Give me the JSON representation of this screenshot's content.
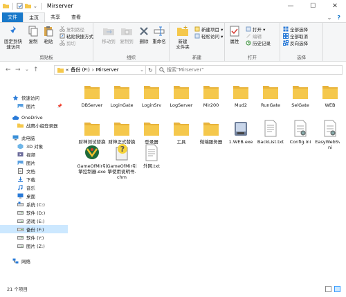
{
  "window": {
    "title": "Mirserver",
    "minimize": "—",
    "maximize": "☐",
    "close": "✕"
  },
  "tabs": [
    {
      "label": "文件"
    },
    {
      "label": "主页"
    },
    {
      "label": "共享"
    },
    {
      "label": "查看"
    }
  ],
  "ribbon": {
    "clipboard": {
      "label": "剪贴板",
      "pin": "固定到快\n速访问",
      "copy": "复制",
      "paste": "粘贴",
      "copy_path": "复制路径",
      "paste_shortcut": "粘贴快捷方式",
      "cut": "剪切"
    },
    "organize": {
      "label": "组织",
      "move_to": "移动到",
      "copy_to": "复制到",
      "delete": "删除",
      "rename": "重命名"
    },
    "new": {
      "label": "新建",
      "new_folder": "新建\n文件夹",
      "new_item": "新建项目 ▾",
      "easy_access": "轻松访问 ▾"
    },
    "open": {
      "label": "打开",
      "properties": "属性",
      "open": "打开 ▾",
      "edit": "编辑",
      "history": "历史记录"
    },
    "select": {
      "label": "选择",
      "select_all": "全部选择",
      "select_none": "全部取消",
      "invert": "反向选择"
    }
  },
  "address": {
    "back": "←",
    "forward": "→",
    "up_history": "⌄",
    "up": "↑",
    "path_prefix": "«",
    "path": [
      "备份 (F:)",
      "Mirserver"
    ],
    "path_sep": "›",
    "dropdown": "⌄",
    "refresh": "↻",
    "search_placeholder": "搜索\"Mirserver\""
  },
  "nav": [
    {
      "label": "快速访问",
      "icon": "star-icon",
      "pinned": false
    },
    {
      "label": "图片",
      "icon": "pictures-folder-icon",
      "pinned": true
    },
    {
      "label": "OneDrive",
      "icon": "cloud-icon",
      "pinned": false
    },
    {
      "label": "战鹰小组登录器",
      "icon": "folder-icon",
      "pinned": false
    },
    {
      "label": "此电脑",
      "icon": "computer-icon",
      "pinned": false
    },
    {
      "label": "3D 对象",
      "icon": "3d-objects-icon",
      "pinned": false
    },
    {
      "label": "视频",
      "icon": "videos-icon",
      "pinned": false
    },
    {
      "label": "图片",
      "icon": "pictures-icon",
      "pinned": false
    },
    {
      "label": "文档",
      "icon": "documents-icon",
      "pinned": false
    },
    {
      "label": "下载",
      "icon": "downloads-icon",
      "pinned": false
    },
    {
      "label": "音乐",
      "icon": "music-icon",
      "pinned": false
    },
    {
      "label": "桌面",
      "icon": "desktop-icon",
      "pinned": false
    },
    {
      "label": "系统 (C:)",
      "icon": "drive-c-icon",
      "pinned": false
    },
    {
      "label": "软件 (D:)",
      "icon": "drive-icon",
      "pinned": false
    },
    {
      "label": "游戏 (E:)",
      "icon": "drive-icon",
      "pinned": false
    },
    {
      "label": "备份 (F:)",
      "icon": "drive-icon",
      "pinned": false,
      "selected": true
    },
    {
      "label": "软件 (Y:)",
      "icon": "drive-icon",
      "pinned": false
    },
    {
      "label": "图片 (Z:)",
      "icon": "drive-icon",
      "pinned": false
    },
    {
      "label": "网络",
      "icon": "network-icon",
      "pinned": false
    }
  ],
  "nav_pin_glyph": "📌",
  "files": [
    {
      "name": "DBServer",
      "type": "folder"
    },
    {
      "name": "LoginGate",
      "type": "folder"
    },
    {
      "name": "LoginSrv",
      "type": "folder"
    },
    {
      "name": "LogServer",
      "type": "folder"
    },
    {
      "name": "Mir200",
      "type": "folder"
    },
    {
      "name": "Mud2",
      "type": "folder"
    },
    {
      "name": "RunGate",
      "type": "folder"
    },
    {
      "name": "SelGate",
      "type": "folder"
    },
    {
      "name": "WEB",
      "type": "folder"
    },
    {
      "name": "财神测试替换",
      "type": "folder"
    },
    {
      "name": "财神正式替换",
      "type": "folder"
    },
    {
      "name": "登录器",
      "type": "folder"
    },
    {
      "name": "工具",
      "type": "folder"
    },
    {
      "name": "微端服务器",
      "type": "folder"
    },
    {
      "name": "1.WEB.exe",
      "type": "exe"
    },
    {
      "name": "BackList.txt",
      "type": "txt"
    },
    {
      "name": "Config.ini",
      "type": "ini"
    },
    {
      "name": "EasyWebSvr.ini",
      "type": "ini"
    },
    {
      "name": "GameOfMir引擎控制器.exe",
      "type": "game-exe"
    },
    {
      "name": "GameOfMir引擎使用说明书.chm",
      "type": "chm"
    },
    {
      "name": "外网.txt",
      "type": "txt"
    }
  ],
  "status": {
    "count": "21 个项目"
  },
  "colors": {
    "accent": "#1979ca",
    "folder": "#f5c84c",
    "selection": "#cce8ff"
  }
}
